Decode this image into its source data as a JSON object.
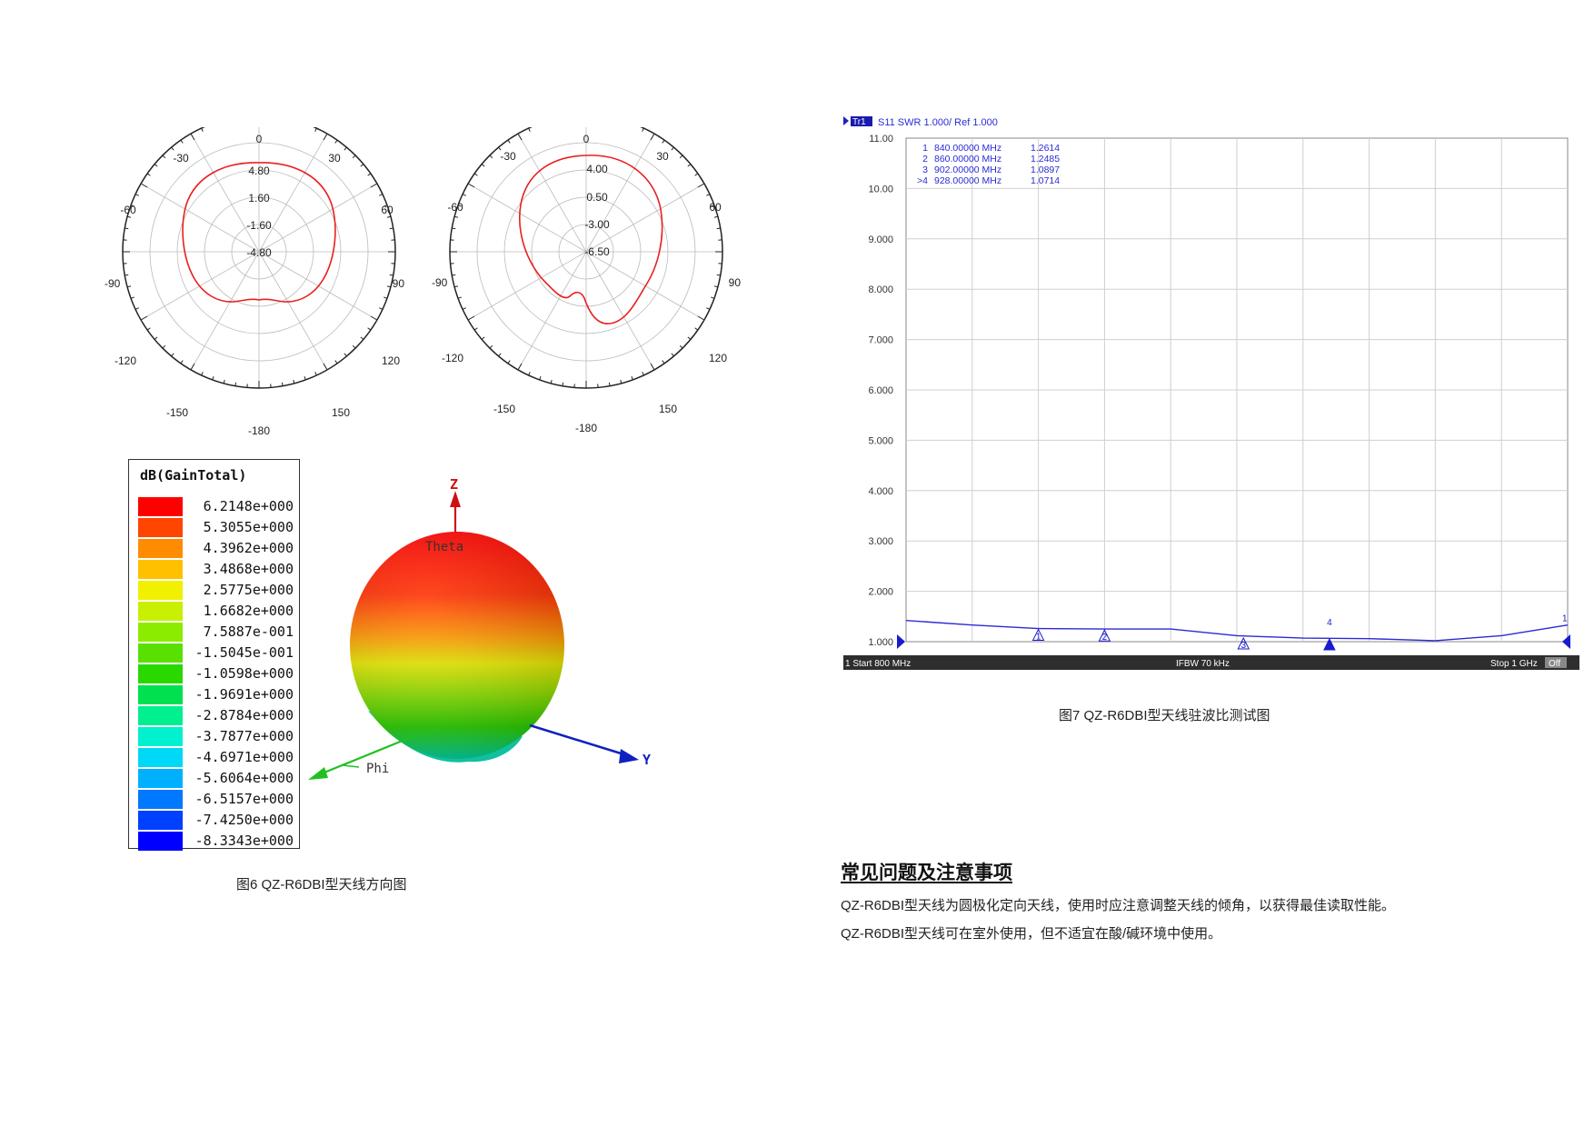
{
  "polar_left": {
    "angle_labels": {
      "top": "0",
      "r30": "30",
      "r60": "60",
      "r90": "90",
      "r120": "120",
      "r150": "150",
      "bottom": "-180",
      "l30": "-30",
      "l60": "-60",
      "l90": "-90",
      "l120": "-120",
      "l150": "-150"
    },
    "ring_labels": [
      "4.80",
      "1.60",
      "-1.60",
      "-4.80"
    ]
  },
  "polar_right": {
    "angle_labels": {
      "top": "0",
      "r30": "30",
      "r60": "60",
      "r90": "90",
      "r120": "120",
      "r150": "150",
      "bottom": "-180",
      "l30": "-30",
      "l60": "-60",
      "l90": "-90",
      "l120": "-120",
      "l150": "-150"
    },
    "ring_labels": [
      "4.00",
      "0.50",
      "-3.00",
      "-6.50"
    ]
  },
  "legend": {
    "title": "dB(GainTotal)",
    "rows": [
      {
        "value": " 6.2148e+000",
        "color": "#ff0000"
      },
      {
        "value": " 5.3055e+000",
        "color": "#ff4500"
      },
      {
        "value": " 4.3962e+000",
        "color": "#ff8c00"
      },
      {
        "value": " 3.4868e+000",
        "color": "#ffc000"
      },
      {
        "value": " 2.5775e+000",
        "color": "#f0f000"
      },
      {
        "value": " 1.6682e+000",
        "color": "#c8f000"
      },
      {
        "value": " 7.5887e-001",
        "color": "#8cec00"
      },
      {
        "value": "-1.5045e-001",
        "color": "#5ae000"
      },
      {
        "value": "-1.0598e+000",
        "color": "#2ad800"
      },
      {
        "value": "-1.9691e+000",
        "color": "#00e050"
      },
      {
        "value": "-2.8784e+000",
        "color": "#00f090"
      },
      {
        "value": "-3.7877e+000",
        "color": "#00f0d0"
      },
      {
        "value": "-4.6971e+000",
        "color": "#00d8f8"
      },
      {
        "value": "-5.6064e+000",
        "color": "#00b0ff"
      },
      {
        "value": "-6.5157e+000",
        "color": "#0078ff"
      },
      {
        "value": "-7.4250e+000",
        "color": "#0040ff"
      },
      {
        "value": "-8.3343e+000",
        "color": "#0000ff"
      }
    ]
  },
  "pattern3d": {
    "axis_z": "Z",
    "axis_y": "Y",
    "label_phi": "Phi",
    "label_theta": "Theta"
  },
  "caption_fig6": "图6 QZ-R6DBI型天线方向图",
  "vna": {
    "header_trace": "Tr1",
    "header_text": "S11  SWR 1.000/ Ref 1.000",
    "marker_table": [
      {
        "id": "1",
        "freq": "840.00000 MHz",
        "val": "1.2614"
      },
      {
        "id": "2",
        "freq": "860.00000 MHz",
        "val": "1.2485"
      },
      {
        "id": "3",
        "freq": "902.00000 MHz",
        "val": "1.0897"
      },
      {
        "id": ">4",
        "freq": "928.00000 MHz",
        "val": "1.0714"
      }
    ],
    "footer_left": "1  Start 800 MHz",
    "footer_mid": "IFBW 70 kHz",
    "footer_right": "Stop 1 GHz",
    "footer_off": "Off",
    "trace_color": "#2a2ad8"
  },
  "chart_data": {
    "type": "line",
    "title": "S11  SWR 1.000/ Ref 1.000",
    "xlabel": "",
    "ylabel": "",
    "x_range_mhz": [
      800,
      1000
    ],
    "ylim": [
      1.0,
      11.0
    ],
    "y_ticks": [
      "1.000",
      "2.000",
      "3.000",
      "4.000",
      "5.000",
      "6.000",
      "7.000",
      "8.000",
      "9.000",
      "10.00",
      "11.00"
    ],
    "series": [
      {
        "x_mhz": [
          800,
          820,
          840,
          860,
          880,
          900,
          920,
          940,
          960,
          980,
          1000
        ],
        "swr": [
          1.42,
          1.33,
          1.26,
          1.25,
          1.25,
          1.12,
          1.07,
          1.06,
          1.02,
          1.12,
          1.33
        ]
      }
    ],
    "markers": [
      {
        "id": "1",
        "x_mhz": 840,
        "swr": 1.2614
      },
      {
        "id": "2",
        "x_mhz": 860,
        "swr": 1.2485
      },
      {
        "id": "3",
        "x_mhz": 902,
        "swr": 1.0897
      },
      {
        "id": "4",
        "x_mhz": 928,
        "swr": 1.0714
      }
    ]
  },
  "caption_fig7": "图7 QZ-R6DBI型天线驻波比测试图",
  "section": {
    "title": "常见问题及注意事项",
    "p1": "QZ-R6DBI型天线为圆极化定向天线，使用时应注意调整天线的倾角，以获得最佳读取性能。",
    "p2": "QZ-R6DBI型天线可在室外使用，但不适宜在酸/碱环境中使用。"
  }
}
